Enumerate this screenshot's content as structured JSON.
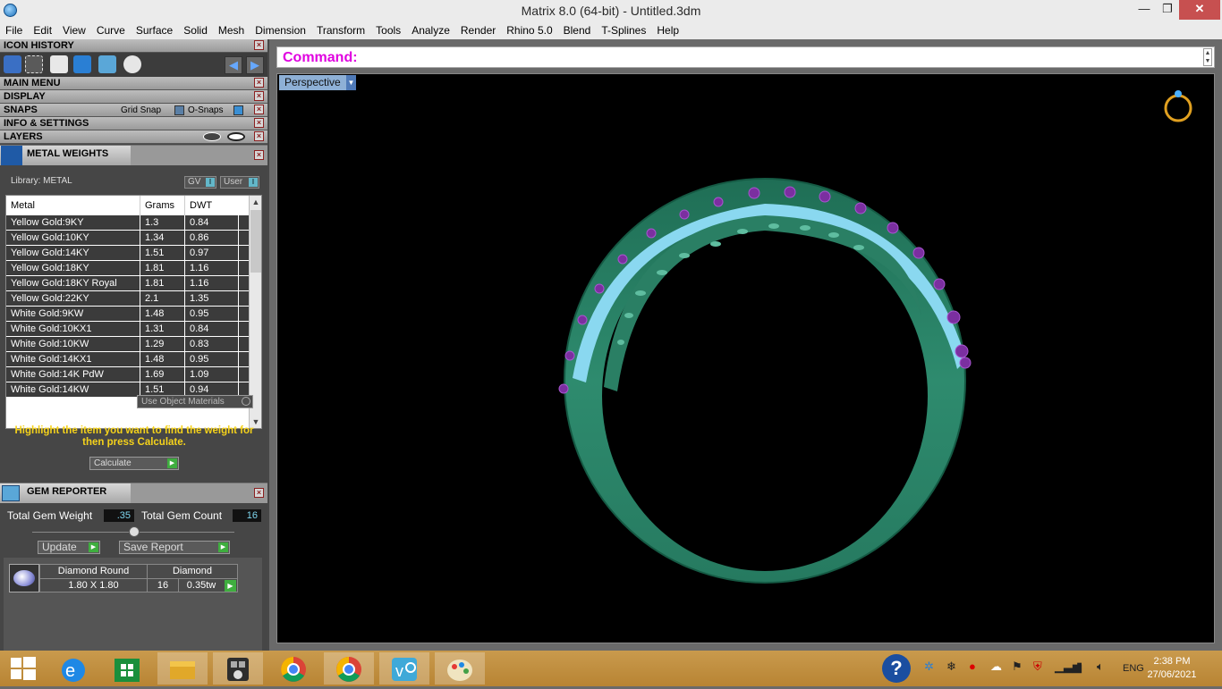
{
  "window": {
    "title": "Matrix 8.0 (64-bit) - Untitled.3dm",
    "minimize": "—",
    "restore": "❐",
    "close": "✕"
  },
  "menu": [
    "File",
    "Edit",
    "View",
    "Curve",
    "Surface",
    "Solid",
    "Mesh",
    "Dimension",
    "Transform",
    "Tools",
    "Analyze",
    "Render",
    "Rhino 5.0",
    "Blend",
    "T-Splines",
    "Help"
  ],
  "left": {
    "icon_history": "ICON HISTORY",
    "main_menu": "MAIN MENU",
    "display": "DISPLAY",
    "snaps": "SNAPS",
    "grid_snap": "Grid Snap",
    "o_snaps": "O-Snaps",
    "info_settings": "INFO & SETTINGS",
    "layers": "LAYERS",
    "metal_weights": {
      "title": "METAL WEIGHTS",
      "library": "Library: METAL",
      "gv": "GV",
      "user": "User",
      "headers": [
        "Metal",
        "Grams",
        "DWT"
      ],
      "rows": [
        [
          "Yellow Gold:9KY",
          "1.3",
          "0.84"
        ],
        [
          "Yellow Gold:10KY",
          "1.34",
          "0.86"
        ],
        [
          "Yellow Gold:14KY",
          "1.51",
          "0.97"
        ],
        [
          "Yellow Gold:18KY",
          "1.81",
          "1.16"
        ],
        [
          "Yellow Gold:18KY Royal",
          "1.81",
          "1.16"
        ],
        [
          "Yellow Gold:22KY",
          "2.1",
          "1.35"
        ],
        [
          "White Gold:9KW",
          "1.48",
          "0.95"
        ],
        [
          "White Gold:10KX1",
          "1.31",
          "0.84"
        ],
        [
          "White Gold:10KW",
          "1.29",
          "0.83"
        ],
        [
          "White Gold:14KX1",
          "1.48",
          "0.95"
        ],
        [
          "White Gold:14K PdW",
          "1.69",
          "1.09"
        ],
        [
          "White Gold:14KW",
          "1.51",
          "0.94"
        ]
      ],
      "use_object_materials": "Use Object Materials",
      "hint": "Highlight the item you want to find the weight for then press Calculate.",
      "calculate": "Calculate"
    },
    "gem_reporter": {
      "title": "GEM REPORTER",
      "total_weight_label": "Total Gem Weight",
      "total_weight_value": ".35",
      "total_count_label": "Total Gem Count",
      "total_count_value": "16",
      "update": "Update",
      "save_report": "Save Report",
      "gem_name": "Diamond Round",
      "gem_type": "Diamond",
      "gem_size": "1.80 X 1.80",
      "gem_count": "16",
      "gem_weight": "0.35tw"
    }
  },
  "command": {
    "label": "Command:"
  },
  "viewport": {
    "name": "Perspective"
  },
  "taskbar": {
    "lang": "ENG",
    "time": "2:38 PM",
    "date": "27/06/2021"
  },
  "colors": {
    "ring_band": "#2e8b6e",
    "stones": "#7b2fa0",
    "setting": "#8ad8f0",
    "command": "#e000e0"
  }
}
